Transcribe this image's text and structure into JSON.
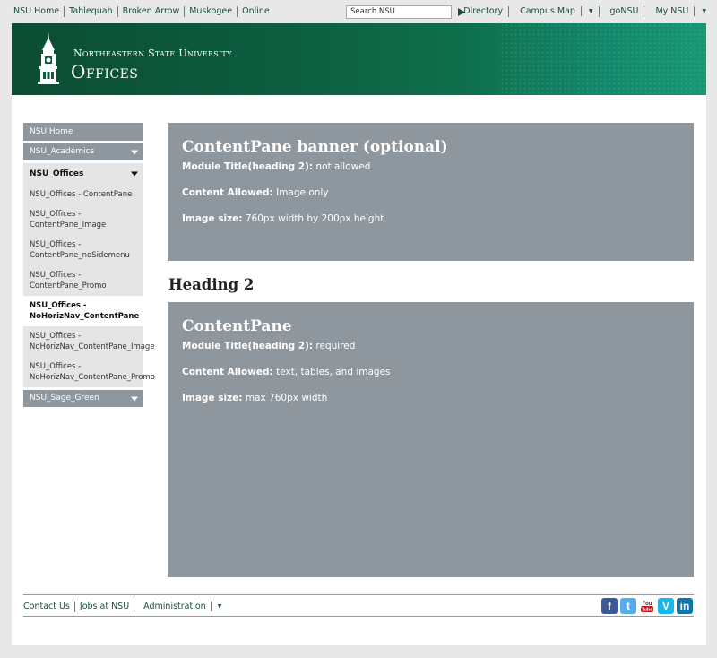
{
  "topnav": {
    "links": [
      "NSU Home",
      "Tahlequah",
      "Broken Arrow",
      "Muskogee",
      "Online"
    ],
    "search_placeholder": "Search NSU",
    "right_links": [
      "Directory",
      "Campus Map",
      "goNSU",
      "My NSU"
    ]
  },
  "banner": {
    "university_name": "Northeastern State University",
    "section": "Offices"
  },
  "sidebar": {
    "home": "NSU Home",
    "academics": "NSU_Academics",
    "offices": "NSU_Offices",
    "items": [
      "NSU_Offices - ContentPane",
      "NSU_Offices - ContentPane_Image",
      "NSU_Offices - ContentPane_noSidemenu",
      "NSU_Offices - ContentPane_Promo",
      "NSU_Offices - NoHorizNav_ContentPane",
      "NSU_Offices - NoHorizNav_ContentPane_Image",
      "NSU_Offices - NoHorizNav_ContentPane_Promo"
    ],
    "sage": "NSU_Sage_Green"
  },
  "pane1": {
    "title": "ContentPane banner (optional)",
    "lines": [
      {
        "label": "Module Title(heading 2):",
        "value": "not allowed"
      },
      {
        "label": "Content Allowed:",
        "value": "Image only"
      },
      {
        "label": "Image size:",
        "value": "760px width by 200px height"
      }
    ]
  },
  "heading2": "Heading 2",
  "pane2": {
    "title": "ContentPane",
    "lines": [
      {
        "label": "Module Title(heading 2):",
        "value": "required"
      },
      {
        "label": "Content Allowed:",
        "value": "text, tables, and images"
      },
      {
        "label": "Image size:",
        "value": "max 760px width"
      }
    ]
  },
  "footer": {
    "links": [
      "Contact Us",
      "Jobs at NSU",
      "Administration"
    ],
    "social": {
      "facebook": "f",
      "twitter": "t",
      "youtube": "You Tube",
      "vimeo": "V",
      "linkedin": "in"
    }
  }
}
